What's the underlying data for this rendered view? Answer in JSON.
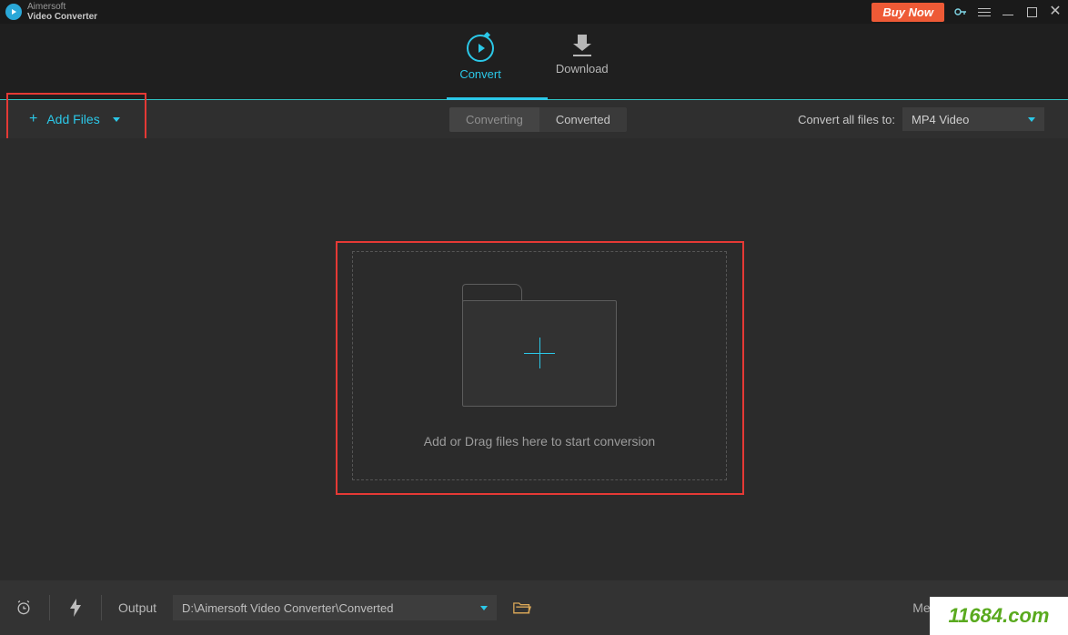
{
  "app": {
    "brand": "Aimersoft",
    "name": "Video Converter",
    "buy_label": "Buy Now"
  },
  "nav": {
    "convert": "Convert",
    "download": "Download"
  },
  "toolbar": {
    "add_files": "Add Files",
    "tab_converting": "Converting",
    "tab_converted": "Converted",
    "convert_all_label": "Convert all files to:",
    "format_selected": "MP4 Video"
  },
  "dropzone": {
    "hint": "Add or Drag files here to start conversion"
  },
  "bottom": {
    "output_label": "Output",
    "output_path": "D:\\Aimersoft Video Converter\\Converted",
    "merge_label": "Merge All Videos"
  },
  "watermark": "11684.com"
}
